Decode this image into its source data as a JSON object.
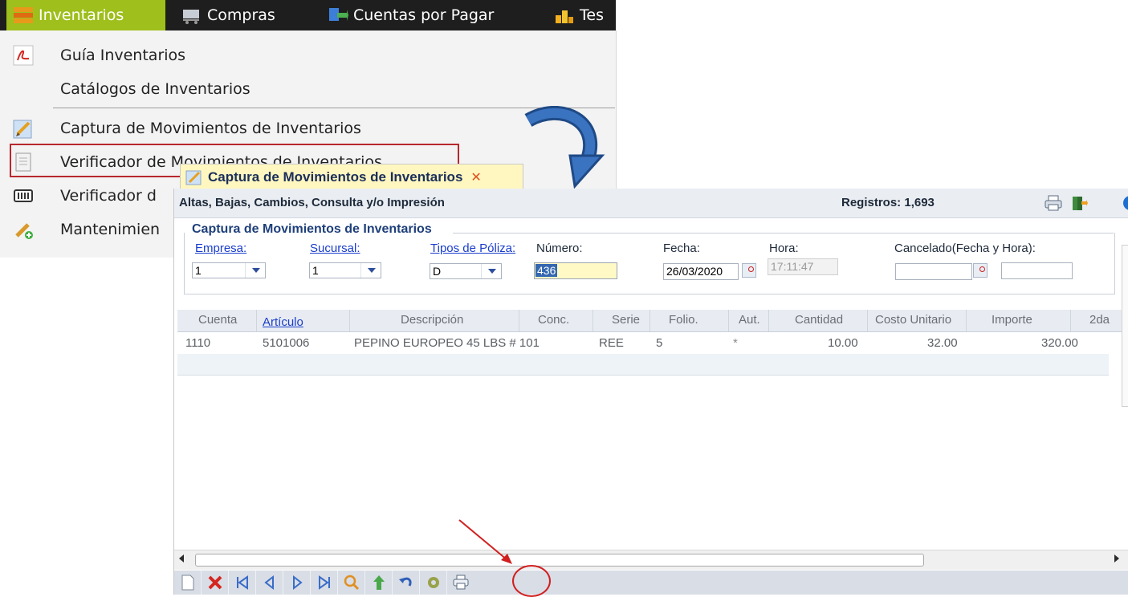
{
  "menubar": {
    "items": [
      {
        "label": "Inventarios",
        "icon": "inventory-icon"
      },
      {
        "label": "Compras",
        "icon": "cart-icon"
      },
      {
        "label": "Cuentas por Pagar",
        "icon": "payables-icon"
      },
      {
        "label": "Tes",
        "icon": "coins-icon"
      }
    ]
  },
  "dropdown": {
    "items": [
      {
        "label": "Guía Inventarios",
        "icon": "pdf-icon"
      },
      {
        "label": "Catálogos de Inventarios",
        "icon": ""
      },
      {
        "label": "Captura de Movimientos de Inventarios",
        "icon": "edit-icon"
      },
      {
        "label": "Verificador de Movimientos de Inventarios",
        "icon": "document-icon"
      },
      {
        "label": "Verificador d",
        "icon": "barcode-icon"
      },
      {
        "label": "Mantenimien",
        "icon": "wrench-icon"
      }
    ]
  },
  "window": {
    "tab_title": "Captura de Movimientos de Inventarios",
    "tab_close": "✕",
    "subtitle": "Altas, Bajas, Cambios, Consulta y/o Impresión",
    "records": "Registros: 1,693"
  },
  "form": {
    "legend": "Captura de Movimientos de Inventarios",
    "empresa_label": "Empresa:",
    "empresa_value": "1",
    "sucursal_label": "Sucursal:",
    "sucursal_value": "1",
    "poliza_label": "Tipos de Póliza:",
    "poliza_value": "D",
    "numero_label": "Número:",
    "numero_value": "436",
    "fecha_label": "Fecha:",
    "fecha_value": "26/03/2020",
    "hora_label": "Hora:",
    "hora_value": "17:11:47",
    "cancelado_label": "Cancelado(Fecha y Hora):",
    "cancelado_date": "",
    "cancelado_time": ""
  },
  "grid": {
    "columns": [
      "Cuenta",
      "Artículo",
      "Descripción",
      "Conc.",
      "Serie",
      "Folio.",
      "Aut.",
      "Cantidad",
      "Costo Unitario",
      "Importe",
      "2da"
    ],
    "rows": [
      {
        "cuenta": "1110",
        "articulo": "5101006",
        "descripcion": "PEPINO EUROPEO 45 LBS # 101",
        "conc": "REE",
        "serie": "5",
        "folio": "",
        "aut": "*",
        "cantidad": "10.00",
        "costo": "32.00",
        "importe": "320.00"
      }
    ]
  },
  "toolbar": {
    "buttons": [
      "new",
      "delete",
      "first",
      "previous",
      "next",
      "last",
      "search",
      "upload",
      "undo",
      "process",
      "print"
    ]
  },
  "colors": {
    "menu_active": "#9ebf1c",
    "highlight": "#b7282e",
    "tab_bg": "#fff7bf",
    "link": "#1a3dcc"
  }
}
